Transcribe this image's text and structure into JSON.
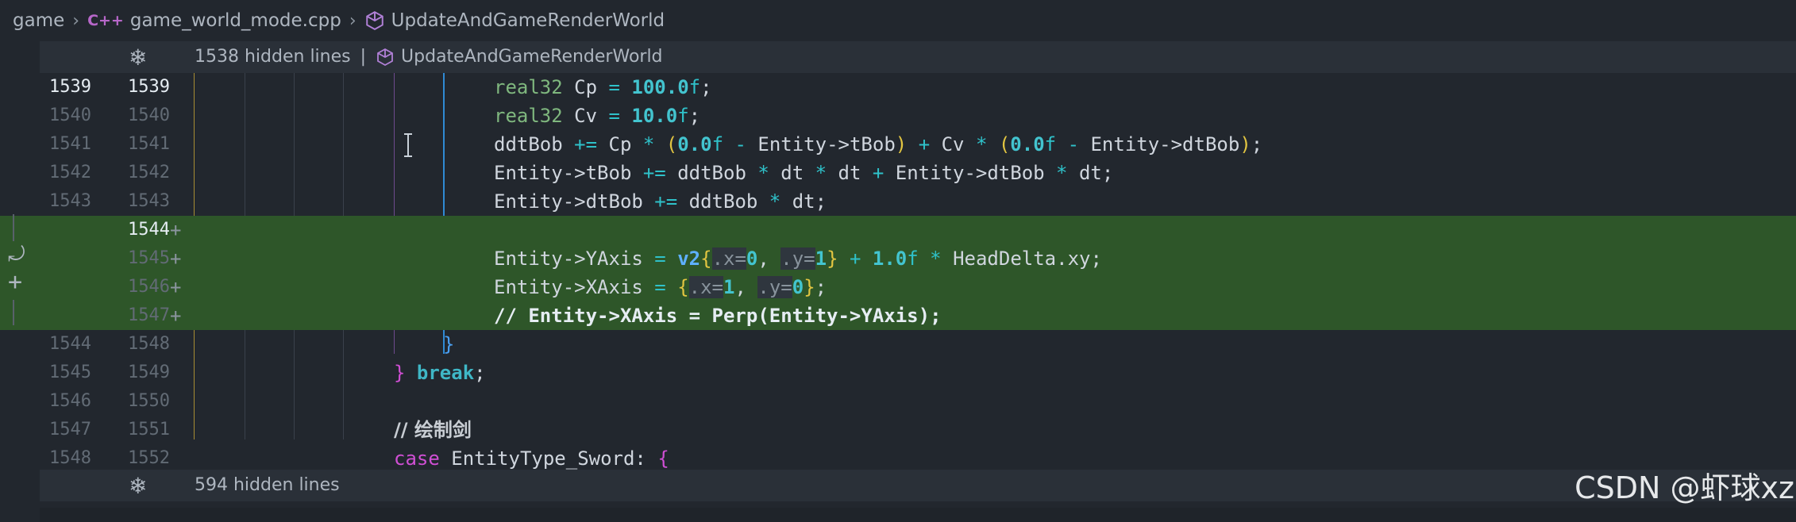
{
  "breadcrumb": {
    "folder": "game",
    "file_icon": "C++",
    "file": "game_world_mode.cpp",
    "symbol": "UpdateAndGameRenderWorld"
  },
  "fold_top": {
    "text": "1538 hidden lines",
    "separator": "|",
    "symbol": "UpdateAndGameRenderWorld"
  },
  "fold_bottom": {
    "text": "594 hidden lines"
  },
  "lines": [
    {
      "old": "1539",
      "new": "1539",
      "added": false,
      "active": true
    },
    {
      "old": "1540",
      "new": "1540",
      "added": false
    },
    {
      "old": "1541",
      "new": "1541",
      "added": false
    },
    {
      "old": "1542",
      "new": "1542",
      "added": false
    },
    {
      "old": "1543",
      "new": "1543",
      "added": false
    },
    {
      "old": "",
      "new": "1544",
      "added": true,
      "active": true
    },
    {
      "old": "",
      "new": "1545",
      "added": true
    },
    {
      "old": "",
      "new": "1546",
      "added": true
    },
    {
      "old": "",
      "new": "1547",
      "added": true
    },
    {
      "old": "1544",
      "new": "1548",
      "added": false
    },
    {
      "old": "1545",
      "new": "1549",
      "added": false
    },
    {
      "old": "1546",
      "new": "1550",
      "added": false
    },
    {
      "old": "1547",
      "new": "1551",
      "added": false
    },
    {
      "old": "1548",
      "new": "1552",
      "added": false
    }
  ],
  "added_marker": "+",
  "code": {
    "l1539": {
      "type": "real32",
      "name": " Cp ",
      "op": "=",
      "num": "100.0",
      "suffix": "f",
      "end": ";"
    },
    "l1540": {
      "type": "real32",
      "name": " Cv ",
      "op": "=",
      "num": "10.0",
      "suffix": "f",
      "end": ";"
    },
    "l1541": {
      "a": "ddtBob ",
      "op1": "+=",
      "b": " Cp ",
      "op2": "*",
      "paren_open": "(",
      "n1": "0.0",
      "f1": "f",
      "op3": "-",
      "c": " Entity->tBob",
      "paren_close": ")",
      "op4": "+",
      "d": " Cv ",
      "op5": "*",
      "n2": "0.0",
      "f2": "f",
      "op6": "-",
      "e": " Entity->dtBob",
      "end": ";"
    },
    "l1542": {
      "a": "Entity->tBob ",
      "op1": "+=",
      "b": " ddtBob ",
      "op2": "*",
      "c": " dt ",
      "op3": "*",
      "d": " dt ",
      "op4": "+",
      "e": " Entity->dtBob ",
      "op5": "*",
      "f": " dt;"
    },
    "l1543": {
      "a": "Entity->dtBob ",
      "op1": "+=",
      "b": " ddtBob ",
      "op2": "*",
      "c": " dt;"
    },
    "l1545": {
      "a": "Entity->YAxis ",
      "op1": "=",
      "v2": "v2",
      "brace_open": "{",
      "hx": ".x=",
      "nx": "0",
      "comma": ", ",
      "hy": ".y=",
      "ny": "1",
      "brace_close": "}",
      "op2": "+",
      "n": "1.0",
      "f": "f",
      "op3": "*",
      "b": " HeadDelta.xy;"
    },
    "l1546": {
      "a": "Entity->XAxis ",
      "op1": "=",
      "brace_open": "{",
      "hx": ".x=",
      "nx": "1",
      "comma": ", ",
      "hy": ".y=",
      "ny": "0",
      "brace_close": "}",
      "end": ";"
    },
    "l1547": {
      "comment": "// Entity->XAxis = Perp(Entity->YAxis);"
    },
    "l1548": {
      "brace": "}"
    },
    "l1549": {
      "brace": "}",
      "kw": "break",
      "end": ";"
    },
    "l1551": {
      "comment": "// 绘制剑"
    },
    "l1552": {
      "kw": "case",
      "name": " EntityType_Sword: ",
      "brace": "{"
    }
  },
  "watermark": "CSDN @虾球xz",
  "colors": {
    "added_bg": "#2e5629",
    "bg": "#22272e",
    "guide_blue": "#2f8ad4"
  }
}
